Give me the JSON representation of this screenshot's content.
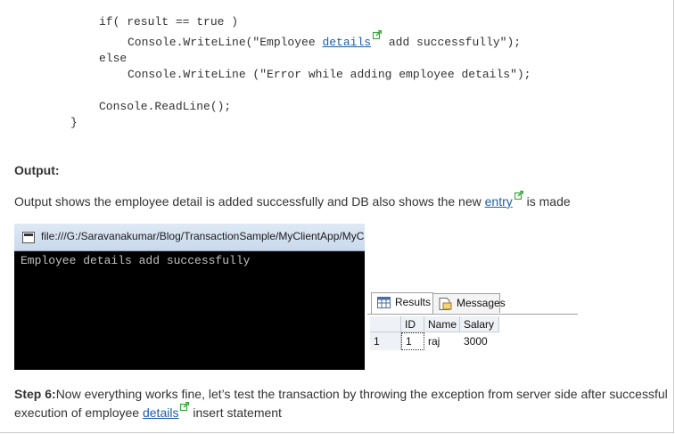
{
  "code": {
    "line1": "if( result == true )",
    "line2_before": "Console.WriteLine(\"Employee ",
    "line2_link": "details",
    "line2_after": " add successfully\");",
    "line3": "else",
    "line4": "Console.WriteLine (\"Error while adding employee details\");",
    "line5": "Console.ReadLine();",
    "line6": "}"
  },
  "output_heading": "Output:",
  "output_text": {
    "before": "Output shows the employee detail is added successfully and DB also shows the new ",
    "link": "entry",
    "after": " is made"
  },
  "console": {
    "title": "file:///G:/Saravanakumar/Blog/TransactionSample/MyClientApp/MyC",
    "output": "Employee details add successfully"
  },
  "results": {
    "tabs": [
      "Results",
      "Messages"
    ],
    "columns": [
      "ID",
      "Name",
      "Salary"
    ],
    "rows": [
      {
        "row_num": "1",
        "id": "1",
        "name": "raj",
        "salary": "3000"
      }
    ]
  },
  "step6": {
    "label": "Step 6:",
    "text1": "Now everything works fine, let’s test the transaction by throwing the exception from server side after successful",
    "text2_before": "execution of employee ",
    "link": "details",
    "text2_after": " insert statement"
  },
  "colors": {
    "link": "#1f5fa8",
    "external_link_icon": "#3aa63a",
    "console_bg": "#000000"
  }
}
